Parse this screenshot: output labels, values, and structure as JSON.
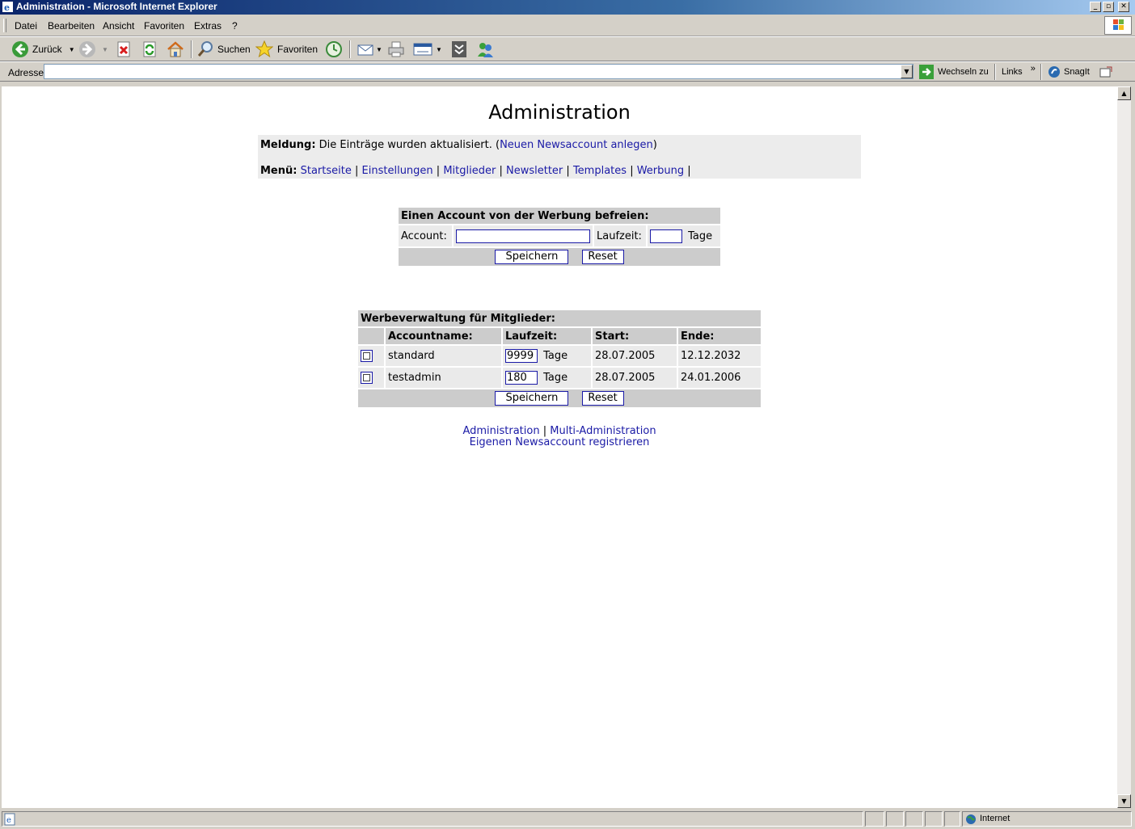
{
  "window": {
    "title": "Administration - Microsoft Internet Explorer",
    "controls": [
      "minimize",
      "maximize",
      "close"
    ]
  },
  "menu": {
    "items": [
      "Datei",
      "Bearbeiten",
      "Ansicht",
      "Favoriten",
      "Extras",
      "?"
    ]
  },
  "toolbar": {
    "back_label": "Zurück",
    "search_label": "Suchen",
    "favorites_label": "Favoriten"
  },
  "addressbar": {
    "label": "Adresse",
    "value": "",
    "go_label": "Wechseln zu",
    "links_label": "Links",
    "snagit_label": "SnagIt"
  },
  "page": {
    "title": "Administration",
    "message": {
      "label": "Meldung:",
      "text": "Die Einträge wurden aktualisiert. (",
      "link": "Neuen Newsaccount anlegen",
      "close": ")"
    },
    "nav": {
      "label": "Menü:",
      "items": [
        "Startseite",
        "Einstellungen",
        "Mitglieder",
        "Newsletter",
        "Templates",
        "Werbung"
      ],
      "separator": "|"
    },
    "free_form": {
      "header": "Einen Account von der Werbung befreien:",
      "account_label": "Account:",
      "account_value": "",
      "runtime_label": "Laufzeit:",
      "runtime_value": "",
      "unit": "Tage",
      "save": "Speichern",
      "reset": "Reset"
    },
    "ad_table": {
      "header": "Werbeverwaltung für Mitglieder:",
      "columns": [
        "Accountname:",
        "Laufzeit:",
        "Start:",
        "Ende:"
      ],
      "rows": [
        {
          "account": "standard",
          "runtime": "9999",
          "unit": "Tage",
          "start": "28.07.2005",
          "end": "12.12.2032",
          "checked": false
        },
        {
          "account": "testadmin",
          "runtime": "180",
          "unit": "Tage",
          "start": "28.07.2005",
          "end": "24.01.2006",
          "checked": false
        }
      ],
      "save": "Speichern",
      "reset": "Reset"
    },
    "footer": {
      "link1": "Administration",
      "sep": "|",
      "link2": "Multi-Administration",
      "link3": "Eigenen Newsaccount registrieren"
    }
  },
  "status": {
    "zone": "Internet"
  },
  "colors": {
    "link": "#1a1aa6",
    "header_bg": "#cccccc",
    "cell_bg": "#eaeaea",
    "message_bg": "#ececec"
  }
}
